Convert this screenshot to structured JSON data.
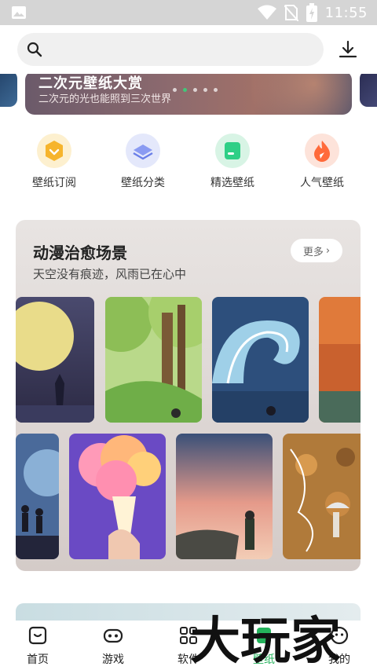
{
  "status_bar": {
    "time": "11:55"
  },
  "search": {
    "placeholder": ""
  },
  "banner": {
    "title": "二次元壁纸大赏",
    "subtitle": "二次元的光也能照到三次世界",
    "dots": 5,
    "active_dot": 1
  },
  "categories": [
    {
      "label": "壁纸订阅",
      "icon": "subscribe-icon",
      "color": "#f6b42c"
    },
    {
      "label": "壁纸分类",
      "icon": "category-icon",
      "color": "#7a8ff0"
    },
    {
      "label": "精选壁纸",
      "icon": "featured-icon",
      "color": "#2ecf86"
    },
    {
      "label": "人气壁纸",
      "icon": "hot-icon",
      "color": "#ff6a3a"
    }
  ],
  "section": {
    "title": "动漫治愈场景",
    "subtitle": "天空没有痕迹，风雨已在心中",
    "more_label": "更多"
  },
  "nav": {
    "items": [
      {
        "label": "首页",
        "icon": "home-icon"
      },
      {
        "label": "游戏",
        "icon": "gamepad-icon"
      },
      {
        "label": "软件",
        "icon": "apps-icon"
      },
      {
        "label": "壁纸",
        "icon": "wallpaper-icon",
        "active": true
      },
      {
        "label": "我的",
        "icon": "profile-icon"
      }
    ]
  },
  "watermark": "大玩家",
  "colors": {
    "accent": "#25b35c"
  }
}
